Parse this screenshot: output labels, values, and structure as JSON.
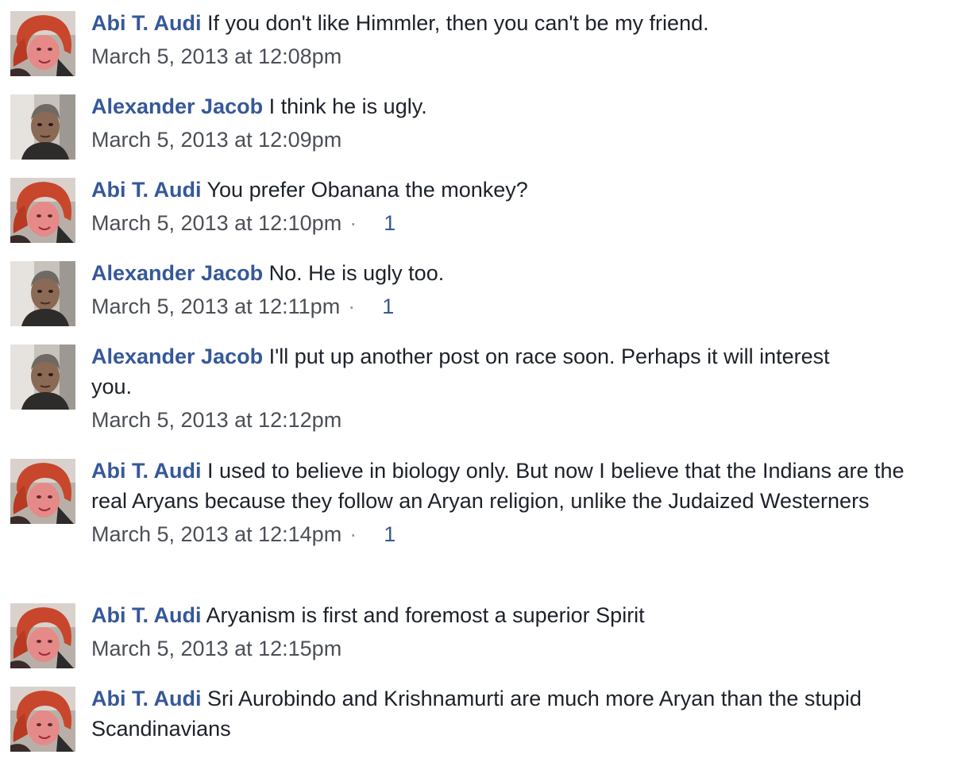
{
  "comments": [
    {
      "author": "Abi T. Audi",
      "avatar": "avatar-red-hair-woman",
      "text": "If you don't like Himmler, then you can't be my friend.",
      "timestamp": "March 5, 2013 at 12:08pm",
      "separator": "",
      "likes": ""
    },
    {
      "author": "Alexander Jacob",
      "avatar": "avatar-man",
      "text": "I think he is ugly.",
      "timestamp": "March 5, 2013 at 12:09pm",
      "separator": "",
      "likes": ""
    },
    {
      "author": "Abi T. Audi",
      "avatar": "avatar-red-hair-woman",
      "text": "You prefer Obanana the monkey?",
      "timestamp": "March 5, 2013 at 12:10pm",
      "separator": "·",
      "likes": "1"
    },
    {
      "author": "Alexander Jacob",
      "avatar": "avatar-man",
      "text": "No. He is ugly too.",
      "timestamp": "March 5, 2013 at 12:11pm",
      "separator": "·",
      "likes": "1"
    },
    {
      "author": "Alexander Jacob",
      "avatar": "avatar-man",
      "text": "I'll put up another post on race soon. Perhaps it will interest you.",
      "timestamp": "March 5, 2013 at 12:12pm",
      "separator": "",
      "likes": ""
    },
    {
      "author": "Abi T. Audi",
      "avatar": "avatar-red-hair-woman",
      "text": "I used to believe in biology only. But now I believe that the Indians are the real Aryans because they follow an Aryan religion, unlike the Judaized Westerners",
      "timestamp": "March 5, 2013 at 12:14pm",
      "separator": "·",
      "likes": "1"
    },
    {
      "author": "Abi T. Audi",
      "avatar": "avatar-red-hair-woman",
      "text": "Aryanism is first and foremost a superior Spirit",
      "timestamp": "March 5, 2013 at 12:15pm",
      "separator": "",
      "likes": ""
    },
    {
      "author": "Abi T. Audi",
      "avatar": "avatar-red-hair-woman",
      "text": "Sri Aurobindo and Krishnamurti are much more Aryan than the stupid Scandinavians",
      "timestamp": "",
      "separator": "",
      "likes": ""
    }
  ],
  "colors": {
    "author_link": "#365899",
    "body_text": "#1d2129",
    "meta_text": "#4b4f56",
    "like_count": "#365899"
  }
}
